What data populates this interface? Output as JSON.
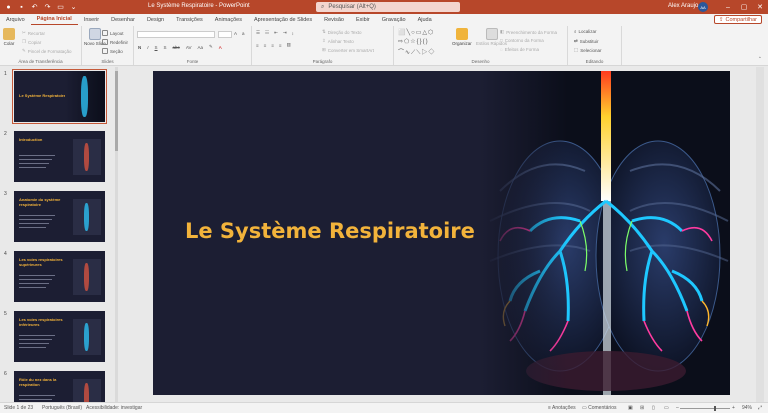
{
  "window": {
    "doc_title": "Le Système Respiratoire  -  PowerPoint",
    "search_placeholder": "Pesquisar (Alt+Q)",
    "user_name": "Alex Araujo",
    "user_initials": "AA"
  },
  "tabs": [
    "Arquivo",
    "Página Inicial",
    "Inserir",
    "Desenhar",
    "Design",
    "Transições",
    "Animações",
    "Apresentação de Slides",
    "Revisão",
    "Exibir",
    "Gravação",
    "Ajuda"
  ],
  "share_label": "Compartilhar",
  "ribbon": {
    "clipboard": {
      "label": "Área de Transferência",
      "paste": "Colar",
      "cut": "Recortar",
      "copy": "Copiar",
      "format_painter": "Pincel de Formatação"
    },
    "slides": {
      "label": "Slides",
      "new_slide": "Novo Slide",
      "layout": "Layout",
      "reset": "Redefinir",
      "section": "Seção"
    },
    "font": {
      "label": "Fonte"
    },
    "paragraph": {
      "label": "Parágrafo",
      "text_direction": "Direção do Texto",
      "align_text": "Alinhar Texto",
      "smartart": "Converter em SmartArt"
    },
    "drawing": {
      "label": "Desenho",
      "arrange": "Organizar",
      "quick_styles": "Estilos Rápidos",
      "shape_fill": "Preenchimento da Forma",
      "shape_outline": "Contorno da Forma",
      "shape_effects": "Efeitos de Forma"
    },
    "editing": {
      "label": "Editando",
      "find": "Localizar",
      "replace": "Substituir",
      "select": "Selecionar"
    }
  },
  "thumbnails": [
    {
      "num": "1",
      "title": "Le Système Respiratoire"
    },
    {
      "num": "2",
      "title": "Introduction"
    },
    {
      "num": "3",
      "title": "Anatomie du système respiratoire"
    },
    {
      "num": "4",
      "title": "Les voies respiratoires supérieures"
    },
    {
      "num": "5",
      "title": "Les voies respiratoires inférieures"
    },
    {
      "num": "6",
      "title": "Rôle du nez dans la respiration"
    }
  ],
  "slide": {
    "title": "Le Système Respiratoire"
  },
  "status": {
    "slide_count": "Slide 1 de 23",
    "language": "Português (Brasil)",
    "accessibility": "Acessibilidade: investigar",
    "notes": "Anotações",
    "comments": "Comentários",
    "zoom": "94%"
  },
  "colors": {
    "accent": "#b7472a",
    "slide_bg": "#1c1e33",
    "title": "#f2b33b"
  }
}
